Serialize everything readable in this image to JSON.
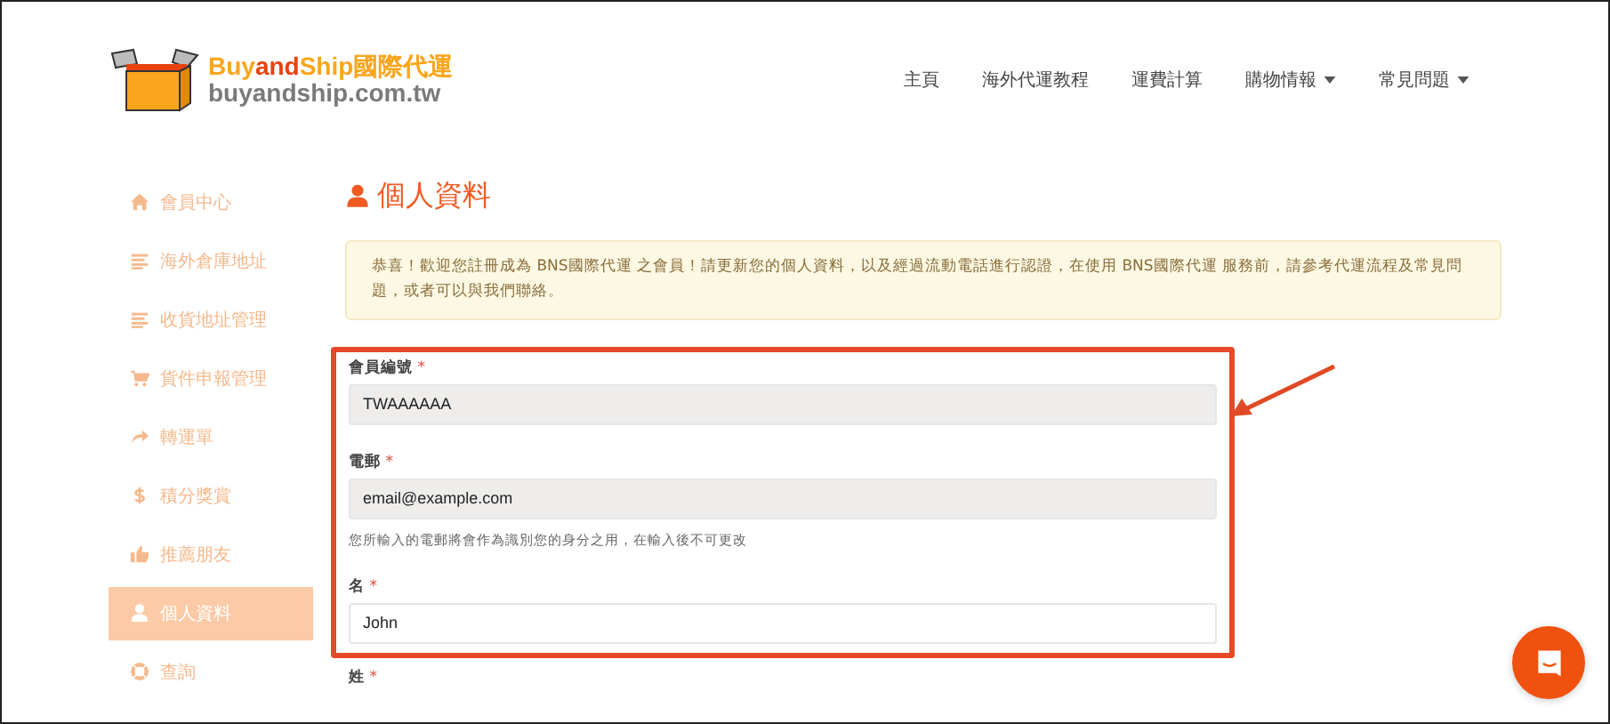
{
  "logo": {
    "title_parts": [
      {
        "text": "Buy",
        "accent": false
      },
      {
        "text": "and",
        "accent": true
      },
      {
        "text": "Ship國際代運",
        "accent": false
      }
    ],
    "domain": "buyandship.com.tw"
  },
  "nav": [
    {
      "label": "主頁",
      "has_dropdown": false
    },
    {
      "label": "海外代運教程",
      "has_dropdown": false
    },
    {
      "label": "運費計算",
      "has_dropdown": false
    },
    {
      "label": "購物情報",
      "has_dropdown": true
    },
    {
      "label": "常見問題",
      "has_dropdown": true
    }
  ],
  "sidebar": {
    "items": [
      {
        "label": "會員中心",
        "selected": false
      },
      {
        "label": "海外倉庫地址",
        "selected": false
      },
      {
        "label": "收貨地址管理",
        "selected": false
      },
      {
        "label": "貨件申報管理",
        "selected": false
      },
      {
        "label": "轉運單",
        "selected": false
      },
      {
        "label": "積分獎賞",
        "selected": false
      },
      {
        "label": "推薦朋友",
        "selected": false
      },
      {
        "label": "個人資料",
        "selected": true
      },
      {
        "label": "查詢",
        "selected": false
      }
    ]
  },
  "page_title": "個人資料",
  "alert": "恭喜！歡迎您註冊成為 BNS國際代運 之會員！請更新您的個人資料，以及經過流動電話進行認證，在使用 BNS國際代運 服務前，請參考代運流程及常見問題，或者可以與我們聯絡。",
  "fields": [
    {
      "label": "會員編號",
      "required_mark": "*",
      "value": "TWAAAAAA",
      "disabled": true
    },
    {
      "label": "電郵",
      "required_mark": "*",
      "value": "email@example.com",
      "disabled": true,
      "help": "您所輸入的電郵將會作為識別您的身分之用，在輸入後不可更改"
    },
    {
      "label": "名",
      "required_mark": "*",
      "value": "John",
      "disabled": false
    }
  ],
  "next_field_label": {
    "label": "姓",
    "required_mark": "*"
  }
}
